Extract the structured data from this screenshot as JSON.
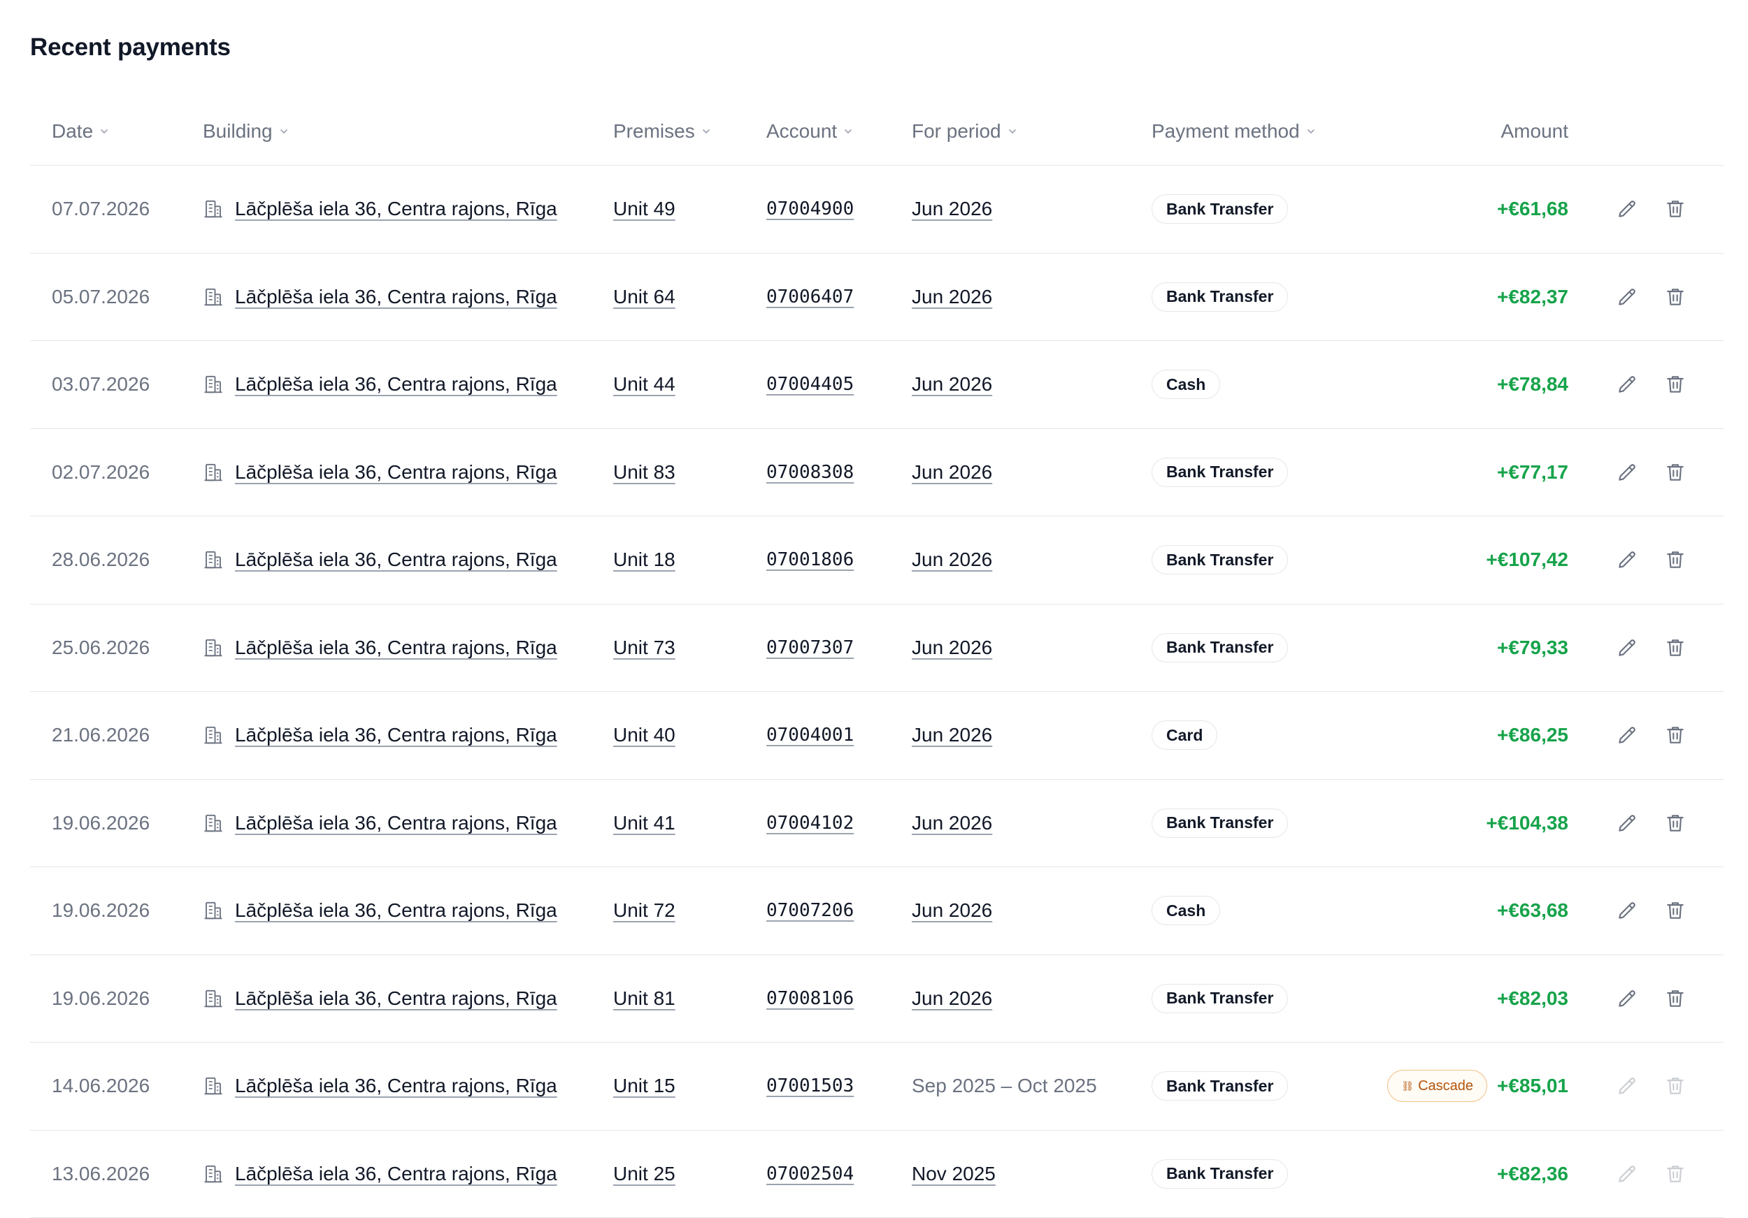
{
  "title": "Recent payments",
  "columns": {
    "date": "Date",
    "building": "Building",
    "premises": "Premises",
    "account": "Account",
    "period": "For period",
    "method": "Payment method",
    "amount": "Amount"
  },
  "icons": {
    "building": "building-icon",
    "sort": "chevron-down-icon",
    "edit": "pencil-icon",
    "delete": "trash-icon",
    "cascade": "cascade-icon"
  },
  "colors": {
    "amount_positive": "#16a34a",
    "cascade_border": "#f3c38a",
    "cascade_text": "#b45309"
  },
  "rows": [
    {
      "date": "07.07.2026",
      "building": "Lāčplēša iela 36, Centra rajons, Rīga",
      "premises": "Unit 49",
      "account": "07004900",
      "period": "Jun 2026",
      "period_linked": true,
      "method": "Bank Transfer",
      "badge": "",
      "amount": "+€61,68",
      "actions_enabled": true
    },
    {
      "date": "05.07.2026",
      "building": "Lāčplēša iela 36, Centra rajons, Rīga",
      "premises": "Unit 64",
      "account": "07006407",
      "period": "Jun 2026",
      "period_linked": true,
      "method": "Bank Transfer",
      "badge": "",
      "amount": "+€82,37",
      "actions_enabled": true
    },
    {
      "date": "03.07.2026",
      "building": "Lāčplēša iela 36, Centra rajons, Rīga",
      "premises": "Unit 44",
      "account": "07004405",
      "period": "Jun 2026",
      "period_linked": true,
      "method": "Cash",
      "badge": "",
      "amount": "+€78,84",
      "actions_enabled": true
    },
    {
      "date": "02.07.2026",
      "building": "Lāčplēša iela 36, Centra rajons, Rīga",
      "premises": "Unit 83",
      "account": "07008308",
      "period": "Jun 2026",
      "period_linked": true,
      "method": "Bank Transfer",
      "badge": "",
      "amount": "+€77,17",
      "actions_enabled": true
    },
    {
      "date": "28.06.2026",
      "building": "Lāčplēša iela 36, Centra rajons, Rīga",
      "premises": "Unit 18",
      "account": "07001806",
      "period": "Jun 2026",
      "period_linked": true,
      "method": "Bank Transfer",
      "badge": "",
      "amount": "+€107,42",
      "actions_enabled": true
    },
    {
      "date": "25.06.2026",
      "building": "Lāčplēša iela 36, Centra rajons, Rīga",
      "premises": "Unit 73",
      "account": "07007307",
      "period": "Jun 2026",
      "period_linked": true,
      "method": "Bank Transfer",
      "badge": "",
      "amount": "+€79,33",
      "actions_enabled": true
    },
    {
      "date": "21.06.2026",
      "building": "Lāčplēša iela 36, Centra rajons, Rīga",
      "premises": "Unit 40",
      "account": "07004001",
      "period": "Jun 2026",
      "period_linked": true,
      "method": "Card",
      "badge": "",
      "amount": "+€86,25",
      "actions_enabled": true
    },
    {
      "date": "19.06.2026",
      "building": "Lāčplēša iela 36, Centra rajons, Rīga",
      "premises": "Unit 41",
      "account": "07004102",
      "period": "Jun 2026",
      "period_linked": true,
      "method": "Bank Transfer",
      "badge": "",
      "amount": "+€104,38",
      "actions_enabled": true
    },
    {
      "date": "19.06.2026",
      "building": "Lāčplēša iela 36, Centra rajons, Rīga",
      "premises": "Unit 72",
      "account": "07007206",
      "period": "Jun 2026",
      "period_linked": true,
      "method": "Cash",
      "badge": "",
      "amount": "+€63,68",
      "actions_enabled": true
    },
    {
      "date": "19.06.2026",
      "building": "Lāčplēša iela 36, Centra rajons, Rīga",
      "premises": "Unit 81",
      "account": "07008106",
      "period": "Jun 2026",
      "period_linked": true,
      "method": "Bank Transfer",
      "badge": "",
      "amount": "+€82,03",
      "actions_enabled": true
    },
    {
      "date": "14.06.2026",
      "building": "Lāčplēša iela 36, Centra rajons, Rīga",
      "premises": "Unit 15",
      "account": "07001503",
      "period": "Sep 2025 – Oct 2025",
      "period_linked": false,
      "method": "Bank Transfer",
      "badge": "Cascade",
      "amount": "+€85,01",
      "actions_enabled": false
    },
    {
      "date": "13.06.2026",
      "building": "Lāčplēša iela 36, Centra rajons, Rīga",
      "premises": "Unit 25",
      "account": "07002504",
      "period": "Nov 2025",
      "period_linked": true,
      "method": "Bank Transfer",
      "badge": "",
      "amount": "+€82,36",
      "actions_enabled": false
    }
  ]
}
